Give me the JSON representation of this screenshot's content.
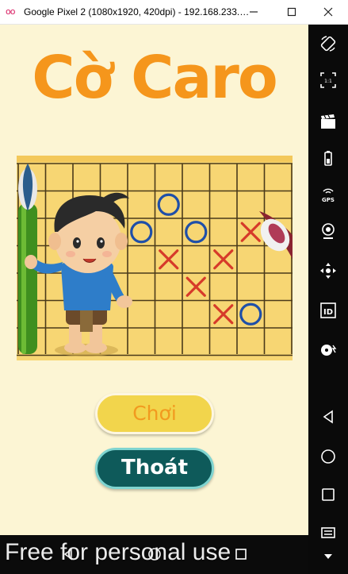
{
  "window": {
    "app_icon": "oo",
    "title": "Google Pixel 2 (1080x1920, 420dpi) - 192.168.233.…",
    "controls": [
      "minimize",
      "maximize",
      "close"
    ]
  },
  "game": {
    "title": "Cờ Caro",
    "play_label": "Chơi",
    "exit_label": "Thoát"
  },
  "board": {
    "colors": {
      "background": "#f7d673",
      "grid": "#4a3a1a",
      "o": "#1f4fa8",
      "x": "#d63a2a"
    },
    "marks": [
      {
        "type": "O",
        "col": 6,
        "row": 2
      },
      {
        "type": "O",
        "col": 5,
        "row": 3
      },
      {
        "type": "O",
        "col": 7,
        "row": 3
      },
      {
        "type": "X",
        "col": 6,
        "row": 4
      },
      {
        "type": "X",
        "col": 8,
        "row": 4
      },
      {
        "type": "X",
        "col": 7,
        "row": 5
      },
      {
        "type": "X",
        "col": 8,
        "row": 6
      },
      {
        "type": "O",
        "col": 9,
        "row": 6
      },
      {
        "type": "X",
        "col": 9,
        "row": 3
      }
    ]
  },
  "side_toolbar": {
    "items": [
      "rotate-icon",
      "scale-1-1-icon",
      "screencast-icon",
      "battery-icon",
      "gps-icon",
      "webcam-icon",
      "dpad-icon",
      "id-icon",
      "media-icon"
    ],
    "nav": [
      "back-icon",
      "home-icon",
      "recents-icon",
      "menu-icon",
      "more-icon"
    ]
  },
  "bottom_nav": [
    "back-icon",
    "home-icon",
    "recents-icon"
  ],
  "watermark": "Free for personal use"
}
